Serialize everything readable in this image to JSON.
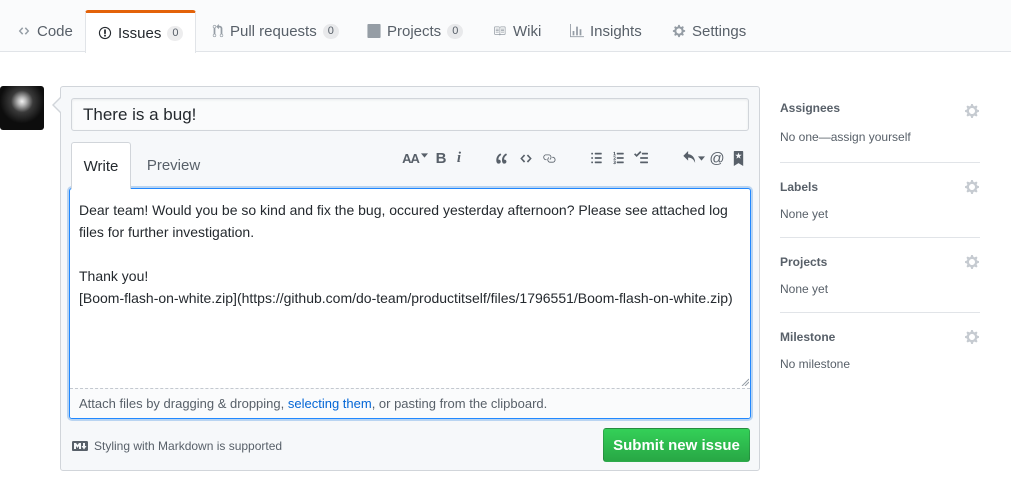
{
  "nav": {
    "tabs": [
      {
        "label": "Code",
        "icon": "code-icon",
        "counter": null,
        "selected": false
      },
      {
        "label": "Issues",
        "icon": "issue-opened-icon",
        "counter": "0",
        "selected": true
      },
      {
        "label": "Pull requests",
        "icon": "git-pull-request-icon",
        "counter": "0",
        "selected": false
      },
      {
        "label": "Projects",
        "icon": "project-icon",
        "counter": "0",
        "selected": false
      },
      {
        "label": "Wiki",
        "icon": "book-icon",
        "counter": null,
        "selected": false
      },
      {
        "label": "Insights",
        "icon": "graph-icon",
        "counter": null,
        "selected": false
      },
      {
        "label": "Settings",
        "icon": "gear-icon",
        "counter": null,
        "selected": false
      }
    ]
  },
  "form": {
    "title_value": "There is a bug!",
    "write_tab": "Write",
    "preview_tab": "Preview",
    "toolbar": {
      "header_label": "AA",
      "bold_label": "B",
      "italic_label": "i",
      "mention_label": "@"
    },
    "body_value": "Dear team! Would you be so kind and fix the bug, occured yesterday afternoon? Please see attached log files for further investigation.\n\nThank you!\n[Boom-flash-on-white.zip](https://github.com/do-team/productitself/files/1796551/Boom-flash-on-white.zip)",
    "attach": {
      "prefix": "Attach files by dragging & dropping, ",
      "link": "selecting them",
      "suffix": ", or pasting from the clipboard."
    },
    "markdown_note": "Styling with Markdown is supported",
    "submit_label": "Submit new issue"
  },
  "sidebar": {
    "sections": [
      {
        "title": "Assignees",
        "value": "No one—assign yourself"
      },
      {
        "title": "Labels",
        "value": "None yet"
      },
      {
        "title": "Projects",
        "value": "None yet"
      },
      {
        "title": "Milestone",
        "value": "No milestone"
      }
    ]
  },
  "colors": {
    "accent_tab": "#e36209",
    "submit_green": "#28a745",
    "link_blue": "#0366d6",
    "focus_blue": "#2188ff"
  }
}
